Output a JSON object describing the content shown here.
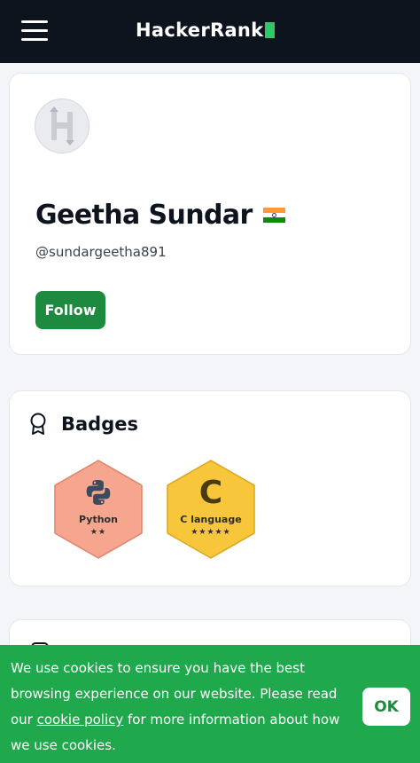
{
  "header": {
    "logo_text": "HackerRank",
    "brand_color": "#2ec866",
    "background": "#0e141e",
    "menu_icon": "hamburger-menu-icon"
  },
  "profile": {
    "avatar_icon": "hackerrank-h-avatar",
    "name": "Geetha Sundar",
    "flag_icon": "india-flag-icon",
    "handle": "@sundargeetha891",
    "follow_label": "Follow",
    "follow_color": "#1e8a3f"
  },
  "badges": {
    "title": "Badges",
    "icon": "award-ribbon-icon",
    "items": [
      {
        "name": "Python",
        "stars": 2,
        "stars_text": "★★",
        "icon": "python-logo-icon",
        "color": "#f6a58e"
      },
      {
        "name": "C language",
        "stars": 5,
        "stars_text": "★★★★★",
        "icon": "c-letter-icon",
        "letter": "C",
        "color": "#f7c63a"
      }
    ]
  },
  "cookie_banner": {
    "text_before": "We use cookies to ensure you have the best browsing experience on our website. Please read our ",
    "link_text": "cookie policy",
    "text_after": " for more information about how we use cookies.",
    "ok_label": "OK",
    "background": "#1fa84c"
  }
}
